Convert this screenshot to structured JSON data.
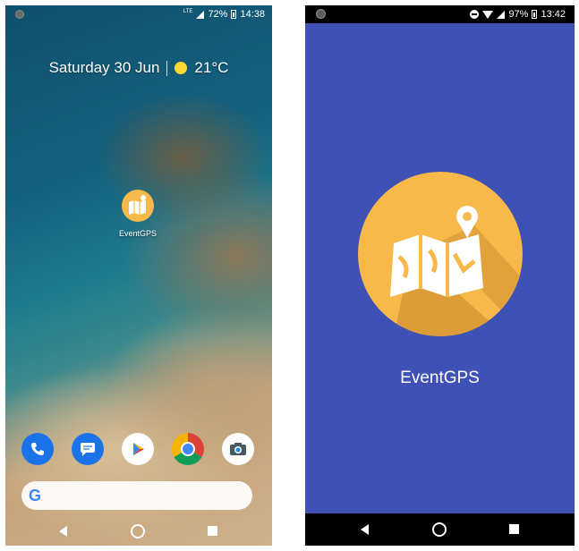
{
  "home_screen": {
    "status_bar": {
      "network": "LTE",
      "battery": "72%",
      "time": "14:38"
    },
    "date_widget": {
      "date": "Saturday 30 Jun",
      "temperature": "21°C",
      "weather_icon": "sun-icon"
    },
    "app": {
      "label": "EventGPS",
      "icon": "map-pin-icon"
    },
    "dock": [
      {
        "icon": "phone-icon"
      },
      {
        "icon": "messages-icon"
      },
      {
        "icon": "play-store-icon"
      },
      {
        "icon": "chrome-icon"
      },
      {
        "icon": "camera-icon"
      }
    ],
    "search_bar": {
      "logo": "G"
    },
    "nav": [
      "back-icon",
      "home-icon",
      "recents-icon"
    ]
  },
  "splash_screen": {
    "status_bar": {
      "battery": "97%",
      "time": "13:42"
    },
    "app_title": "EventGPS",
    "background_color": "#3f51b5",
    "logo_color": "#f6b94a"
  }
}
